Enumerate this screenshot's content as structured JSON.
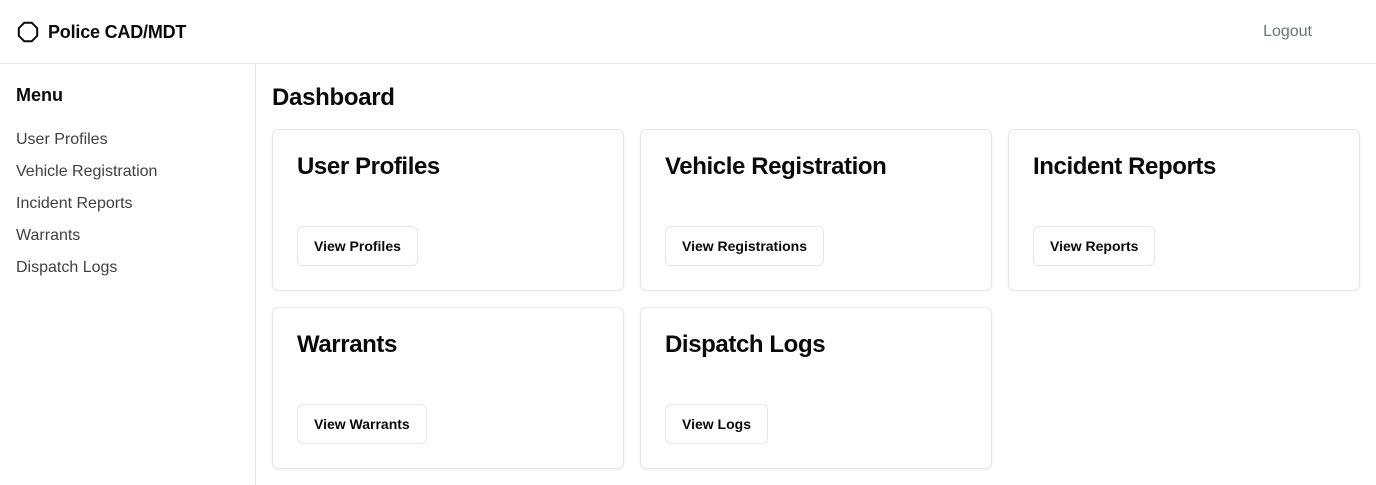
{
  "header": {
    "brand_icon": "octagon-outline-icon",
    "title": "Police CAD/MDT",
    "logout_label": "Logout"
  },
  "sidebar": {
    "title": "Menu",
    "items": [
      {
        "label": "User Profiles"
      },
      {
        "label": "Vehicle Registration"
      },
      {
        "label": "Incident Reports"
      },
      {
        "label": "Warrants"
      },
      {
        "label": "Dispatch Logs"
      }
    ]
  },
  "main": {
    "title": "Dashboard",
    "cards": [
      {
        "title": "User Profiles",
        "button_label": "View Profiles"
      },
      {
        "title": "Vehicle Registration",
        "button_label": "View Registrations"
      },
      {
        "title": "Incident Reports",
        "button_label": "View Reports"
      },
      {
        "title": "Warrants",
        "button_label": "View Warrants"
      },
      {
        "title": "Dispatch Logs",
        "button_label": "View Logs"
      }
    ]
  },
  "colors": {
    "border": "#e5e7eb",
    "text": "#0a0a0a",
    "muted_text": "#6b7280",
    "menu_text": "#404040",
    "background": "#ffffff"
  }
}
